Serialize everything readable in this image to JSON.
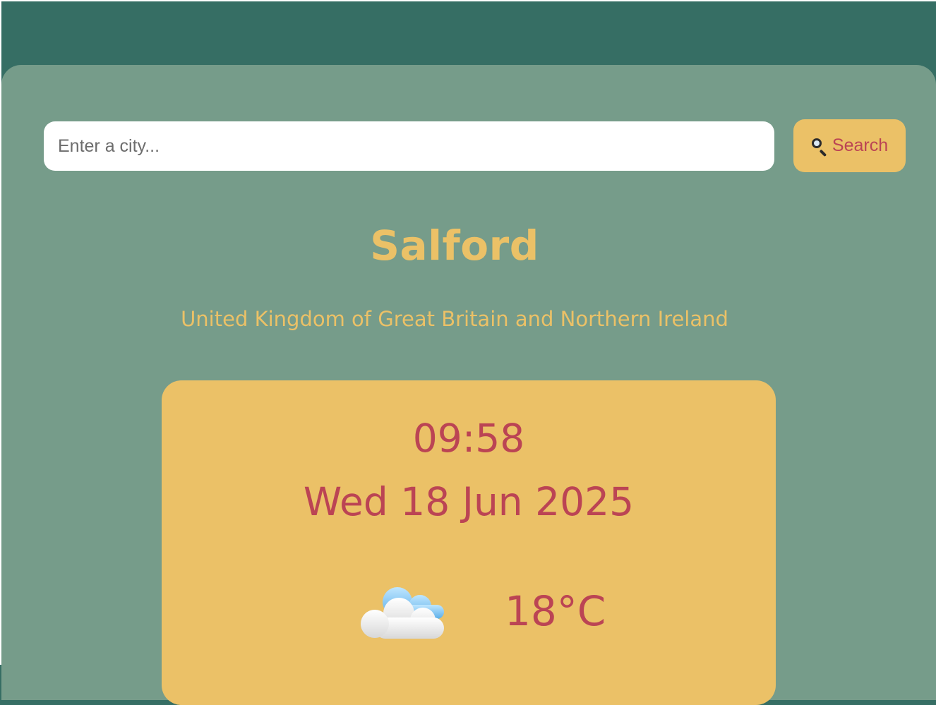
{
  "search": {
    "placeholder": "Enter a city...",
    "value": "",
    "button_label": "Search",
    "button_icon": "magnifying-glass-icon"
  },
  "location": {
    "city": "Salford",
    "country": "United Kingdom of Great Britain and Northern Ireland"
  },
  "weather": {
    "time": "09:58",
    "date": "Wed 18 Jun 2025",
    "icon": "cloud-icon",
    "temperature": "18°C"
  },
  "colors": {
    "background": "#366e64",
    "panel": "#769c8a",
    "accent": "#ebc167",
    "text_accent": "#bb4454"
  }
}
